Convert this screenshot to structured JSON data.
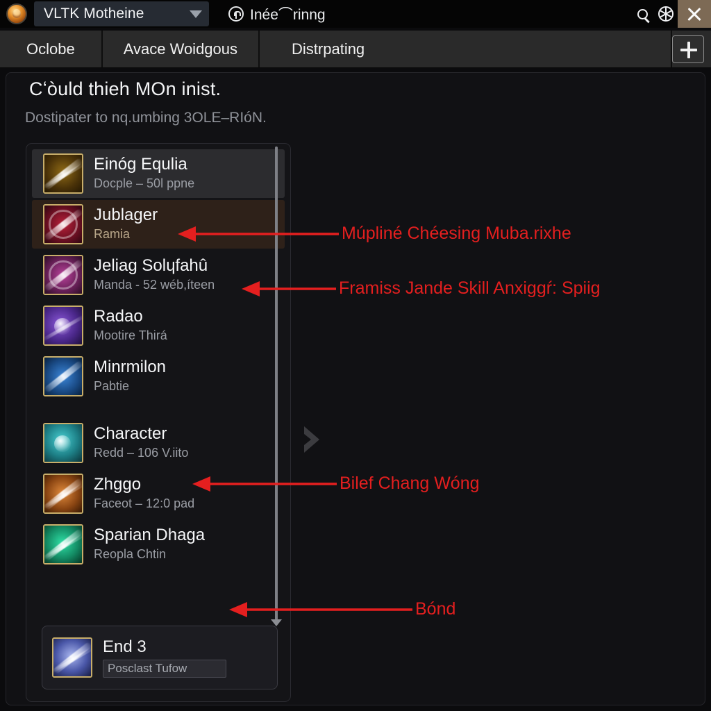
{
  "titlebar": {
    "emblem_icon": "lion-emblem-icon",
    "project_select_value": "VLTK Motheine",
    "caret_icon": "chevron-down-icon",
    "pin_icon": "pin-circle-icon",
    "section_label": "Inée⌒rinng",
    "search_icon": "search-icon",
    "wheel_icon": "wheel-icon",
    "close_icon": "close-icon"
  },
  "tabbar": {
    "tabs": [
      {
        "label": "Oclobe"
      },
      {
        "label": "Avace Woidgous"
      },
      {
        "label": "Distrpating"
      }
    ],
    "add_tab_icon": "plus-icon",
    "add_tab_label": "+"
  },
  "main": {
    "heading": "Cʻòuld thieh MOn inist.",
    "subheading": "Dostipater to nq.umbing 3OLE–RIóN.",
    "expander_icon": "chevron-right-icon",
    "scroll_down_icon": "caret-down-icon",
    "list_items": [
      {
        "title": "Einóg Equlia",
        "sub": "Docple – 50l ppne",
        "icon": "crossed-staff-icon",
        "state": "selected-grey"
      },
      {
        "title": "Jublager",
        "sub": "Ramia",
        "icon": "red-arrow-icon",
        "state": "selected-brown"
      },
      {
        "title": "Jeliag Solɥfahû",
        "sub": "Manda - 52 wéb,íteen",
        "icon": "violet-blade-icon",
        "state": "normal"
      },
      {
        "title": "Radao",
        "sub": "Mootire Thirá",
        "icon": "purple-comet-icon",
        "state": "normal"
      },
      {
        "title": "Minrmilon",
        "sub": "Pabtie",
        "icon": "blue-spear-icon",
        "state": "normal"
      },
      {
        "title": "Character",
        "sub": "Redd – 106 V.iito",
        "icon": "teal-gem-icon",
        "state": "gap"
      },
      {
        "title": "Zhggo",
        "sub": "Faceot – 12:0 pad",
        "icon": "orange-feather-icon",
        "state": "normal"
      },
      {
        "title": "Sparian Dhaga",
        "sub": "Reopla Chtin",
        "icon": "green-blade-icon",
        "state": "normal"
      }
    ],
    "bottom_card": {
      "title": "End 3",
      "icon": "white-blade-icon",
      "input_value": "Posclast Tufow",
      "input_placeholder": "Posclast Tufow"
    }
  },
  "annotations": [
    {
      "label": "Múpliné Chéesing Muba.rixhe"
    },
    {
      "label": "Framiss Jande Skill Anxiggŕ: Spiig"
    },
    {
      "label": "Bilef Chang Wóng"
    },
    {
      "label": "Bónd"
    }
  ],
  "colors": {
    "annotation_red": "#e41f1f",
    "accent_gold": "#c8ae6a",
    "close_button": "#7d6a55"
  }
}
